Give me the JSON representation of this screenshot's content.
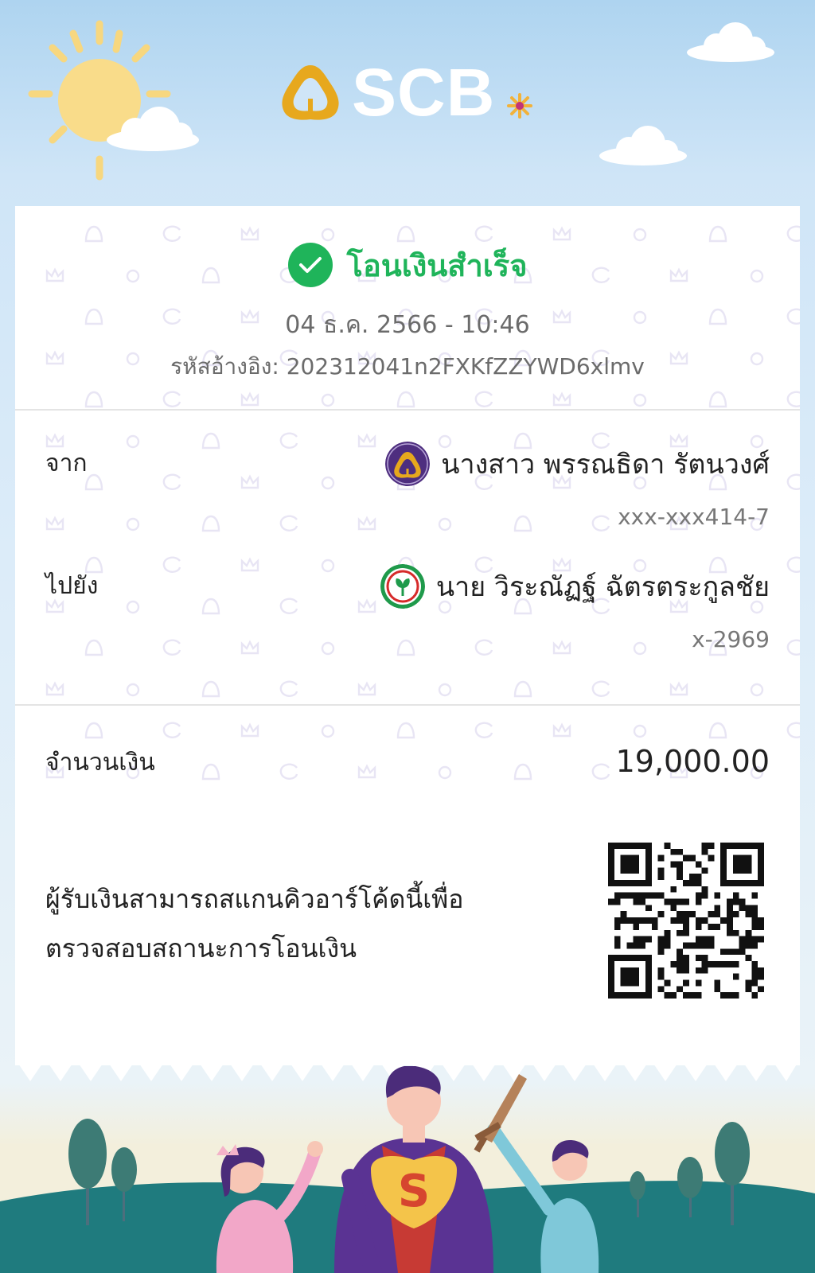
{
  "brand": {
    "name": "SCB",
    "gold": "#e7a81d",
    "purple": "#4e2e7f"
  },
  "transfer": {
    "status": "โอนเงินสำเร็จ",
    "datetime": "04 ธ.ค. 2566 - 10:46",
    "reference": "รหัสอ้างอิง: 202312041n2FXKfZZYWD6xlmv",
    "status_color": "#1fb45a"
  },
  "from": {
    "label": "จาก",
    "name": "นางสาว พรรณธิดา รัตนวงศ์",
    "account": "xxx-xxx414-7",
    "bank_icon": "scb-bank-icon"
  },
  "to": {
    "label": "ไปยัง",
    "name": "นาย วิระณัฏฐ์ ฉัตรตระกูลชัย",
    "account": "x-2969",
    "bank_icon": "kbank-bank-icon"
  },
  "amount": {
    "label": "จำนวนเงิน",
    "value": "19,000.00"
  },
  "qr_note": {
    "line1": "ผู้รับเงินสามารถสแกนคิวอาร์โค้ดนี้เพื่อ",
    "line2": "ตรวจสอบสถานะการโอนเงิน"
  }
}
